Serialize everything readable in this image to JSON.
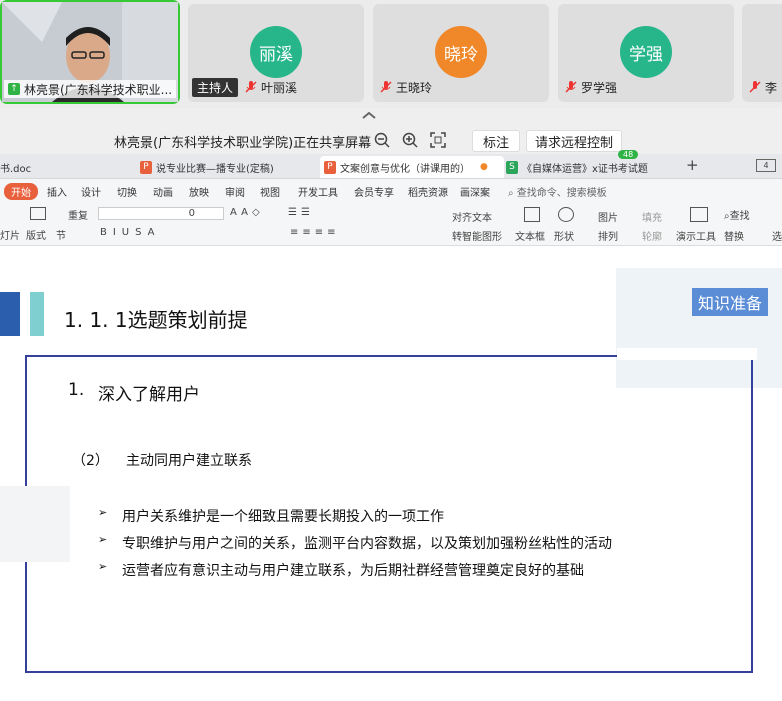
{
  "participants": {
    "self": {
      "name": "林亮景(广东科学技术职业..."
    },
    "tiles": [
      {
        "avatar": "丽溪",
        "name": "叶丽溪",
        "badge": "主持人",
        "color": "#27b58a"
      },
      {
        "avatar": "晓玲",
        "name": "王晓玲",
        "color": "#f0882a"
      },
      {
        "avatar": "学强",
        "name": "罗学强",
        "color": "#27b58a"
      },
      {
        "name": "李"
      }
    ]
  },
  "share_bar": {
    "status": "林亮景(广东科学技术职业学院)正在共享屏幕",
    "annotate": "标注",
    "remote_control": "请求远程控制"
  },
  "doc_tabs": [
    {
      "label": "书.doc"
    },
    {
      "label": "说专业比赛—播专业(定稿)",
      "icon": "P"
    },
    {
      "label": "文案创意与优化（讲课用的）",
      "icon": "P"
    },
    {
      "label": "《自媒体运营》x证书考试题",
      "icon": "S"
    }
  ],
  "tab_count": "48",
  "menu": [
    "开始",
    "插入",
    "设计",
    "切换",
    "动画",
    "放映",
    "审阅",
    "视图",
    "开发工具",
    "会员专享",
    "稻壳资源",
    "画深案"
  ],
  "search_hint": "查找命令、搜索模板",
  "ribbon": {
    "redo": "重复",
    "layout": "版式",
    "section": "节",
    "slide": "灯片",
    "font_size": "0",
    "align_text": "对齐文本",
    "smartart": "转智能图形",
    "textbox": "文本框",
    "shape": "形状",
    "picture": "图片",
    "fill": "填充",
    "arrange": "排列",
    "outline": "轮廓",
    "present_tools": "演示工具",
    "find": "查找",
    "replace": "替换",
    "select": "选"
  },
  "slide": {
    "section": "1. 1. 1选题策划前提",
    "badge": "知识准备",
    "h1_num": "1.",
    "h1": "深入了解用户",
    "h2_num": "（2）",
    "h2": "主动同用户建立联系",
    "bullets": [
      "用户关系维护是一个细致且需要长期投入的一项工作",
      "专职维护与用户之间的关系，监测平台内容数据，以及策划加强粉丝粘性的活动",
      "运营者应有意识主动与用户建立联系，为后期社群经营管理奠定良好的基础"
    ],
    "bullet_marker": "➢"
  }
}
